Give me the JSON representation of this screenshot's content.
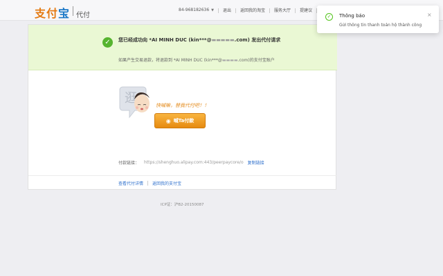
{
  "header": {
    "logo_text_orange": "支付",
    "logo_text_blue": "宝",
    "logo_sub": "代付",
    "account": "84-968182636",
    "nav": [
      "退出",
      "返回我的淘宝",
      "服务大厅",
      "提建议",
      "更"
    ]
  },
  "success": {
    "title": "您已经成功向 *AI MINH DUC (kin***@",
    "title_masked": "▬▬▬▬▬",
    "title_end": ".com) 发出代付请求",
    "subtitle": "如果产生交易退款，将退款到 *AI MINH DUC (kin***@",
    "subtitle_masked": "▬▬▬▬",
    "subtitle_end": ".com)的支付宝账户"
  },
  "illustration": {
    "speech": "快喊嘛，替我代付吧！！",
    "button_label": "喊Ta付款"
  },
  "link": {
    "label": "付款链接：",
    "url": "https://shenghuo.alipay.com:443/peerpaycore/o",
    "copy": "复制链接"
  },
  "footer": {
    "view_detail": "查看代付详情",
    "back": "返回我的支付宝"
  },
  "icp": "ICP证：沪B2-20150087",
  "toast": {
    "title": "Thông báo",
    "message": "Gửi thông tin thanh toán hộ thành công"
  },
  "colors": {
    "success_band": "#eaf8d4",
    "check_green": "#56b42f",
    "button_orange": "#f0a028",
    "link_blue": "#2d6fcc"
  }
}
